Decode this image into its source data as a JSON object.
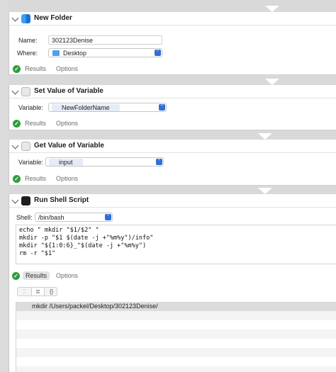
{
  "actions": [
    {
      "title": "New Folder",
      "icon": "finder-icon",
      "fields": {
        "name_label": "Name:",
        "name_value": "302123Denise",
        "where_label": "Where:",
        "where_value": "Desktop"
      },
      "footer": {
        "results": "Results",
        "options": "Options"
      }
    },
    {
      "title": "Set Value of Variable",
      "icon": "variable-icon",
      "fields": {
        "variable_label": "Variable:",
        "variable_value": "NewFolderName"
      },
      "footer": {
        "results": "Results",
        "options": "Options"
      }
    },
    {
      "title": "Get Value of Variable",
      "icon": "variable-icon",
      "fields": {
        "variable_label": "Variable:",
        "variable_value": "input"
      },
      "footer": {
        "results": "Results",
        "options": "Options"
      }
    },
    {
      "title": "Run Shell Script",
      "icon": "terminal-icon",
      "fields": {
        "shell_label": "Shell:",
        "shell_value": "/bin/bash"
      },
      "script": "echo \" mkdir \"$1/$2\" \"\nmkdir -p \"$1 $(date -j +\"%m%y\")/info\"\nmkdir \"${1:0:6}_\"$(date -j +\"%m%y\")\nrm -r \"$1\"",
      "footer": {
        "results": "Results",
        "options": "Options"
      },
      "view_toggle": {
        "list": "≣",
        "code": "{}"
      },
      "results": [
        "mkdir /Users/packel/Desktop/302123Denise/"
      ]
    }
  ],
  "colors": {
    "accent": "#2f6fd6",
    "success": "#2e9d3d"
  }
}
